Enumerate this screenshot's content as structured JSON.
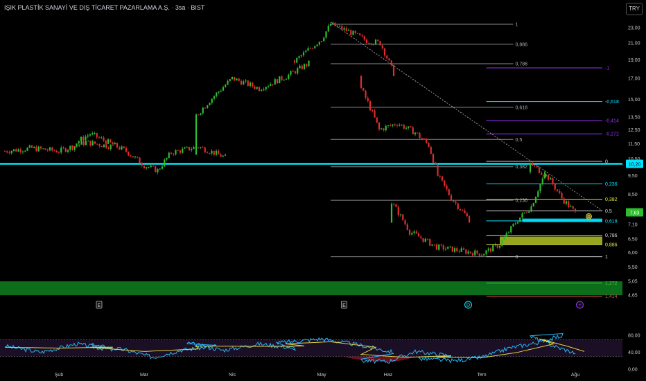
{
  "header": {
    "title": "IŞIK PLASTİK SANAYİ VE DIŞ TİCARET PAZARLAMA A.Ş. · 3sa · BIST",
    "currency": "TRY"
  },
  "colors": {
    "up": "#2ebd2e",
    "down": "#e02d2d",
    "cyan": "#00e5ff",
    "purple": "#9b30ff",
    "yellow": "#e6e64a",
    "gray": "#9a9a9a",
    "green_zone": "#0d7a1e",
    "olive_zone": "#a8b820"
  },
  "chart_data": [
    {
      "type": "candlestick",
      "x_axis": {
        "tick_labels": [
          "Şub",
          "Mar",
          "Nis",
          "May",
          "Haz",
          "Tem",
          "Ağu"
        ]
      },
      "y_axis": {
        "scale": "log",
        "tick_labels": [
          "23,00",
          "21,00",
          "19,00",
          "17,00",
          "15,00",
          "13,50",
          "12,50",
          "11,50",
          "10,50",
          "9,50",
          "8,50",
          "7,10",
          "6,50",
          "6,00",
          "5,50",
          "5,05",
          "4,65"
        ],
        "ylim": [
          4.3,
          25.0
        ]
      },
      "price_labels": [
        {
          "value": 10.2,
          "text": "10,20",
          "color": "cyan"
        },
        {
          "value": 7.63,
          "text": "7,63",
          "color": "up"
        }
      ],
      "path": [
        [
          "Şub",
          -0.6,
          11.0
        ],
        [
          "Şub",
          -0.3,
          11.2
        ],
        [
          "Şub",
          0.0,
          11.0
        ],
        [
          "Şub",
          0.3,
          11.6
        ],
        [
          "Şub",
          0.6,
          11.3
        ],
        [
          "Mar",
          -0.8,
          11.4
        ],
        [
          "Mar",
          -0.6,
          12.2
        ],
        [
          "Mar",
          -0.4,
          11.6
        ],
        [
          "Mar",
          -0.2,
          11.0
        ],
        [
          "Mar",
          0.0,
          10.1
        ],
        [
          "Mar",
          0.15,
          9.8
        ],
        [
          "Mar",
          0.3,
          10.9
        ],
        [
          "Mar",
          0.6,
          11.3
        ],
        [
          "Mar",
          0.9,
          10.6
        ],
        [
          "Nis",
          -0.4,
          13.6
        ],
        [
          "Nis",
          0.0,
          17.0
        ],
        [
          "Nis",
          0.3,
          16.0
        ],
        [
          "Nis",
          0.6,
          17.2
        ],
        [
          "Nis",
          0.85,
          18.6
        ],
        [
          "May",
          -0.3,
          18.8
        ],
        [
          "May",
          0.0,
          21.5
        ],
        [
          "May",
          0.1,
          23.5
        ],
        [
          "May",
          0.3,
          22.5
        ],
        [
          "May",
          0.5,
          21.3
        ],
        [
          "May",
          0.65,
          21.0
        ],
        [
          "May",
          0.8,
          17.5
        ],
        [
          "Haz",
          -0.3,
          16.0
        ],
        [
          "Haz",
          -0.1,
          12.5
        ],
        [
          "Haz",
          0.1,
          13.0
        ],
        [
          "Haz",
          0.3,
          12.3
        ],
        [
          "Haz",
          0.45,
          11.4
        ],
        [
          "Haz",
          0.55,
          9.5
        ],
        [
          "Haz",
          0.7,
          8.3
        ],
        [
          "Haz",
          0.9,
          7.3
        ],
        [
          "Tem",
          -1.0,
          8.1
        ],
        [
          "Tem",
          -0.8,
          6.8
        ],
        [
          "Tem",
          -0.5,
          6.2
        ],
        [
          "Tem",
          0.0,
          5.95
        ],
        [
          "Tem",
          0.2,
          6.3
        ],
        [
          "Tem",
          0.4,
          7.3
        ],
        [
          "Tem",
          0.55,
          7.9
        ],
        [
          "Tem",
          0.7,
          9.6
        ],
        [
          "Ağu",
          -0.5,
          10.2
        ],
        [
          "Ağu",
          -0.3,
          9.4
        ],
        [
          "Ağu",
          -0.15,
          8.3
        ],
        [
          "Ağu",
          0.0,
          7.6
        ]
      ]
    },
    {
      "type": "fibonacci_retracement",
      "name": "fib-retracement-main",
      "x_range": [
        [
          "May",
          0.1
        ],
        [
          "Tem",
          0.35
        ]
      ],
      "levels": [
        {
          "label": "1",
          "value": 23.5
        },
        {
          "label": "0,886",
          "value": 20.85
        },
        {
          "label": "0,786",
          "value": 18.55
        },
        {
          "label": "0,618",
          "value": 14.3
        },
        {
          "label": "0,5",
          "value": 11.8
        },
        {
          "label": "0,382",
          "value": 10.02
        },
        {
          "label": "0,236",
          "value": 8.2
        },
        {
          "label": "0",
          "value": 5.85
        }
      ]
    },
    {
      "type": "fibonacci_extension",
      "name": "fib-extension-right",
      "x_range": [
        [
          "Tem",
          0.05
        ],
        [
          "Ağu",
          0.3
        ]
      ],
      "levels": [
        {
          "label": "-1",
          "value": 18.1,
          "color": "purple"
        },
        {
          "label": "-0,618",
          "value": 14.8,
          "color": "cyan"
        },
        {
          "label": "-0,414",
          "value": 13.2,
          "color": "purple"
        },
        {
          "label": "-0,272",
          "value": 12.2,
          "color": "purple"
        },
        {
          "label": "0",
          "value": 10.35,
          "color": "white"
        },
        {
          "label": "0,236",
          "value": 9.05,
          "color": "cyan"
        },
        {
          "label": "0,382",
          "value": 8.25,
          "color": "yellow"
        },
        {
          "label": "0,5",
          "value": 7.7,
          "color": "white"
        },
        {
          "label": "0,618",
          "value": 7.25,
          "color": "cyan"
        },
        {
          "label": "0,786",
          "value": 6.65,
          "color": "white"
        },
        {
          "label": "0,886",
          "value": 6.3,
          "color": "yellow"
        },
        {
          "label": "1",
          "value": 5.85,
          "color": "white"
        },
        {
          "label": "1,272",
          "value": 5.0,
          "color": "green"
        },
        {
          "label": "1,414",
          "value": 4.62,
          "color": "red"
        }
      ]
    },
    {
      "type": "rsi",
      "y_axis": {
        "tick_labels": [
          "80,00",
          "40,00",
          "0,00"
        ],
        "ylim": [
          0,
          100
        ]
      },
      "band": [
        30,
        70
      ],
      "rsi_path": [
        [
          "Şub",
          -0.6,
          55
        ],
        [
          "Şub",
          -0.2,
          40
        ],
        [
          "Şub",
          0.2,
          60
        ],
        [
          "Şub",
          0.6,
          45
        ],
        [
          "Mar",
          -0.6,
          58
        ],
        [
          "Mar",
          -0.2,
          45
        ],
        [
          "Mar",
          0.1,
          28
        ],
        [
          "Mar",
          0.4,
          45
        ],
        [
          "Mar",
          0.8,
          55
        ],
        [
          "Nis",
          -0.5,
          62
        ],
        [
          "Nis",
          -0.1,
          45
        ],
        [
          "Nis",
          0.3,
          60
        ],
        [
          "Nis",
          0.7,
          50
        ],
        [
          "May",
          -0.5,
          62
        ],
        [
          "May",
          0.0,
          72
        ],
        [
          "May",
          0.4,
          58
        ],
        [
          "May",
          0.8,
          40
        ],
        [
          "Haz",
          -0.3,
          20
        ],
        [
          "Haz",
          0.0,
          18
        ],
        [
          "Haz",
          0.3,
          42
        ],
        [
          "Haz",
          0.7,
          32
        ],
        [
          "Tem",
          -0.7,
          25
        ],
        [
          "Tem",
          -0.3,
          20
        ],
        [
          "Tem",
          0.0,
          28
        ],
        [
          "Tem",
          0.3,
          50
        ],
        [
          "Tem",
          0.6,
          62
        ],
        [
          "Tem",
          0.9,
          80
        ],
        [
          "Ağu",
          -0.5,
          78
        ],
        [
          "Ağu",
          -0.2,
          52
        ],
        [
          "Ağu",
          0.0,
          38
        ]
      ],
      "ma_path": [
        [
          "Şub",
          -0.6,
          52
        ],
        [
          "Şub",
          0.0,
          50
        ],
        [
          "Şub",
          0.6,
          52
        ],
        [
          "Mar",
          -0.6,
          52
        ],
        [
          "Mar",
          0.0,
          42
        ],
        [
          "Mar",
          0.6,
          48
        ],
        [
          "Nis",
          -0.4,
          55
        ],
        [
          "Nis",
          0.3,
          54
        ],
        [
          "Nis",
          0.8,
          55
        ],
        [
          "May",
          -0.4,
          60
        ],
        [
          "May",
          0.1,
          65
        ],
        [
          "May",
          0.6,
          52
        ],
        [
          "Haz",
          -0.3,
          35
        ],
        [
          "Haz",
          0.2,
          28
        ],
        [
          "Haz",
          0.7,
          32
        ],
        [
          "Tem",
          -0.5,
          28
        ],
        [
          "Tem",
          0.0,
          27
        ],
        [
          "Tem",
          0.4,
          40
        ],
        [
          "Tem",
          0.8,
          60
        ],
        [
          "Ağu",
          -0.4,
          72
        ],
        [
          "Ağu",
          -0.1,
          55
        ],
        [
          "Ağu",
          0.1,
          42
        ]
      ]
    }
  ],
  "zones": [
    {
      "name": "green-support-zone",
      "from": 4.65,
      "to": 5.05,
      "color": "green_zone"
    },
    {
      "name": "olive-target-zone",
      "from": 6.28,
      "to": 6.6,
      "color": "olive_zone",
      "x_from": [
        "Tem",
        0.2
      ],
      "x_to": [
        "Ağu",
        0.3
      ]
    },
    {
      "name": "cyan-level-box",
      "from": 7.2,
      "to": 7.35,
      "color": "cyan",
      "x_from": [
        "Tem",
        0.45
      ],
      "x_to": [
        "Ağu",
        0.3
      ]
    }
  ],
  "horizontal_lines": [
    {
      "name": "cyan-horizontal-line",
      "value": 10.2,
      "color": "cyan"
    }
  ],
  "trend_line": {
    "from": [
      [
        "May",
        0.1
      ],
      23.8
    ],
    "to": [
      [
        "Ağu",
        0.3
      ],
      7.7
    ]
  },
  "markers": [
    {
      "name": "event-marker-e1",
      "text": "E",
      "x": [
        "Mar",
        -0.5
      ],
      "style": "box"
    },
    {
      "name": "event-marker-e2",
      "text": "E",
      "x": [
        "May",
        0.25
      ],
      "style": "box"
    },
    {
      "name": "event-marker-d-left",
      "text": "D",
      "x": [
        "Tem",
        -0.15
      ],
      "style": "circle",
      "color": "cyan"
    },
    {
      "name": "event-marker-d-right",
      "text": "D",
      "x": [
        "Ağu",
        0.15
      ],
      "style": "circle-small",
      "color": "yellow"
    },
    {
      "name": "event-marker-split",
      "text": "÷",
      "x": [
        "Ağu",
        0.05
      ],
      "style": "circle",
      "color": "purple"
    }
  ]
}
